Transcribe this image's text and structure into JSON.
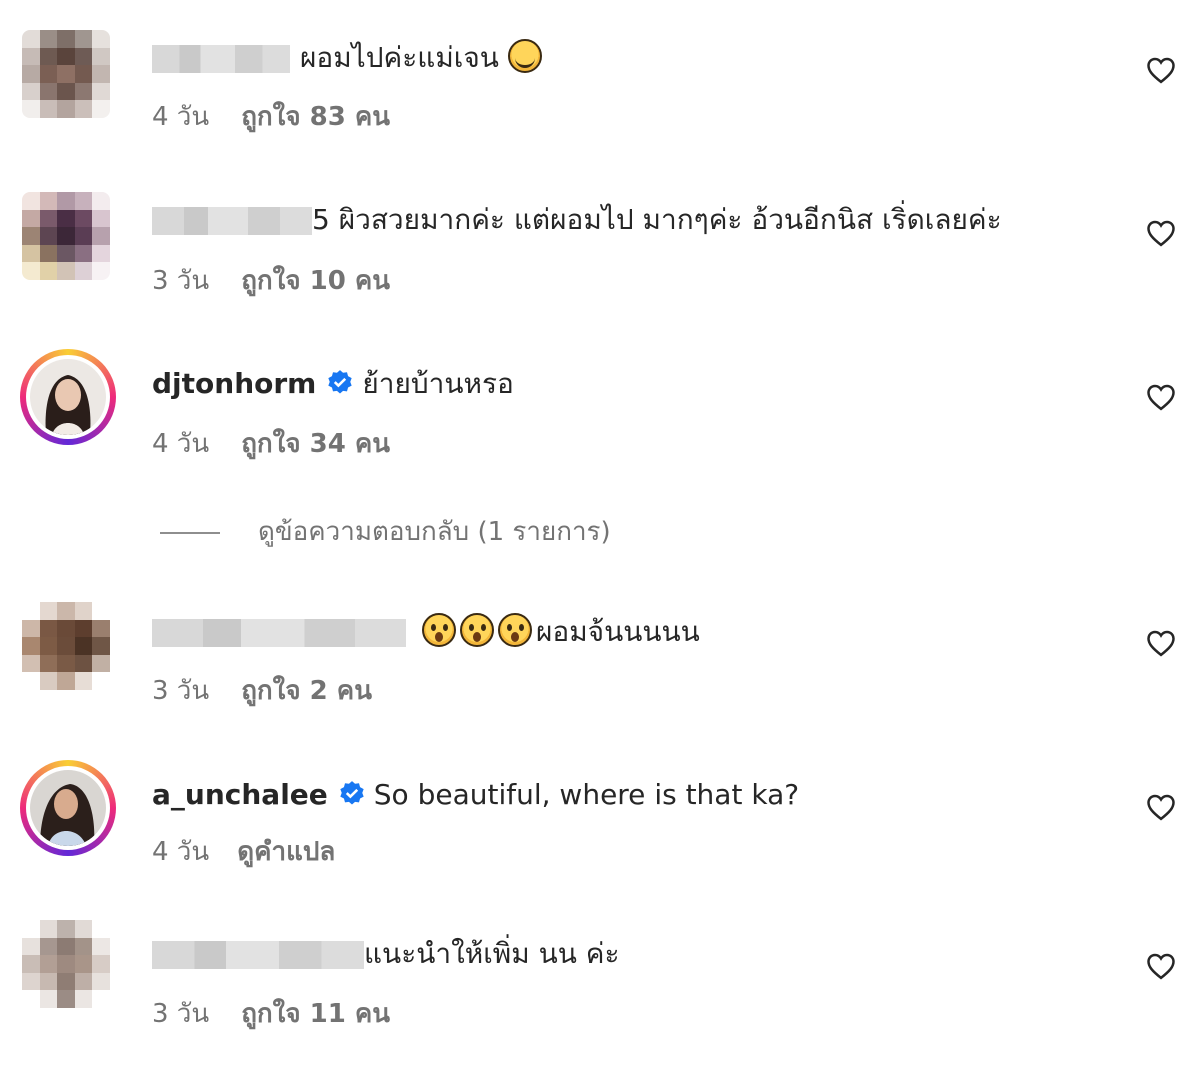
{
  "comments": [
    {
      "text": "ผอมไปค่ะแม่เจน",
      "time": "4 วัน",
      "likes": "ถูกใจ 83 คน"
    },
    {
      "text": "5 ผิวสวยมากค่ะ แต่ผอมไป มากๆค่ะ อ้วนอีกนิส เริ่ดเลยค่ะ",
      "time": "3 วัน",
      "likes": "ถูกใจ 10 คน"
    },
    {
      "username": "djtonhorm",
      "text": "ย้ายบ้านหรอ",
      "time": "4 วัน",
      "likes": "ถูกใจ 34 คน",
      "replies": "ดูข้อความตอบกลับ (1 รายการ)"
    },
    {
      "text": "ผอมจ้นนนนน",
      "time": "3 วัน",
      "likes": "ถูกใจ 2 คน"
    },
    {
      "username": "a_unchalee",
      "text": "So beautiful, where is that ka?",
      "time": "4 วัน",
      "translate": "ดูคำแปล"
    },
    {
      "text": "แนะนำให้เพิ่ม นน ค่ะ",
      "time": "3 วัน",
      "likes": "ถูกใจ 11 คน"
    }
  ],
  "colors": {
    "verified": "#1877f2",
    "meta_text": "#737373",
    "text": "#262626"
  },
  "icons": {
    "like": "heart-outline-icon",
    "verified": "verified-badge-icon",
    "reaction": "astonished-face-emoji"
  }
}
